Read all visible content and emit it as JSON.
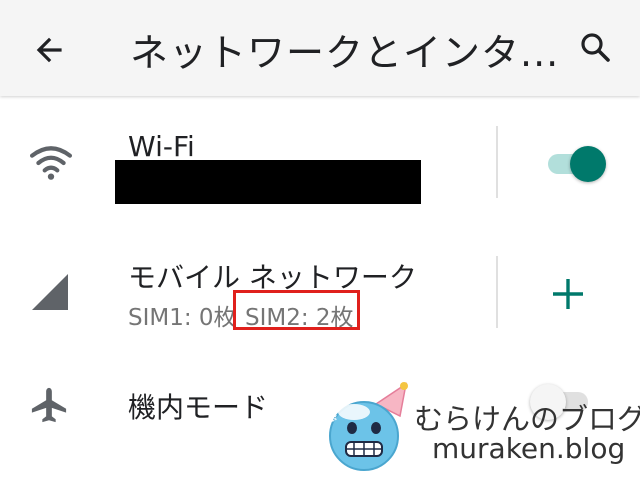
{
  "header": {
    "title": "ネットワークとインタ...",
    "back_icon": "arrow-back-icon",
    "search_icon": "search-icon"
  },
  "wifi": {
    "label": "Wi-Fi",
    "icon": "wifi-icon",
    "toggle_state": "on"
  },
  "mobile": {
    "label": "モバイル ネットワーク",
    "sim1": "SIM1: 0枚",
    "sim2": "SIM2: 2枚",
    "icon": "cellular-signal-icon",
    "action_icon": "add-icon"
  },
  "airplane": {
    "label": "機内モード",
    "icon": "airplane-icon",
    "toggle_state": "off"
  },
  "watermark": {
    "line1": "むらけんのブログ",
    "line2": "muraken.blog"
  },
  "colors": {
    "accent": "#00796b",
    "accent_light": "#b2dfdb",
    "highlight_box": "#e0201c",
    "secondary_text": "#757575"
  }
}
